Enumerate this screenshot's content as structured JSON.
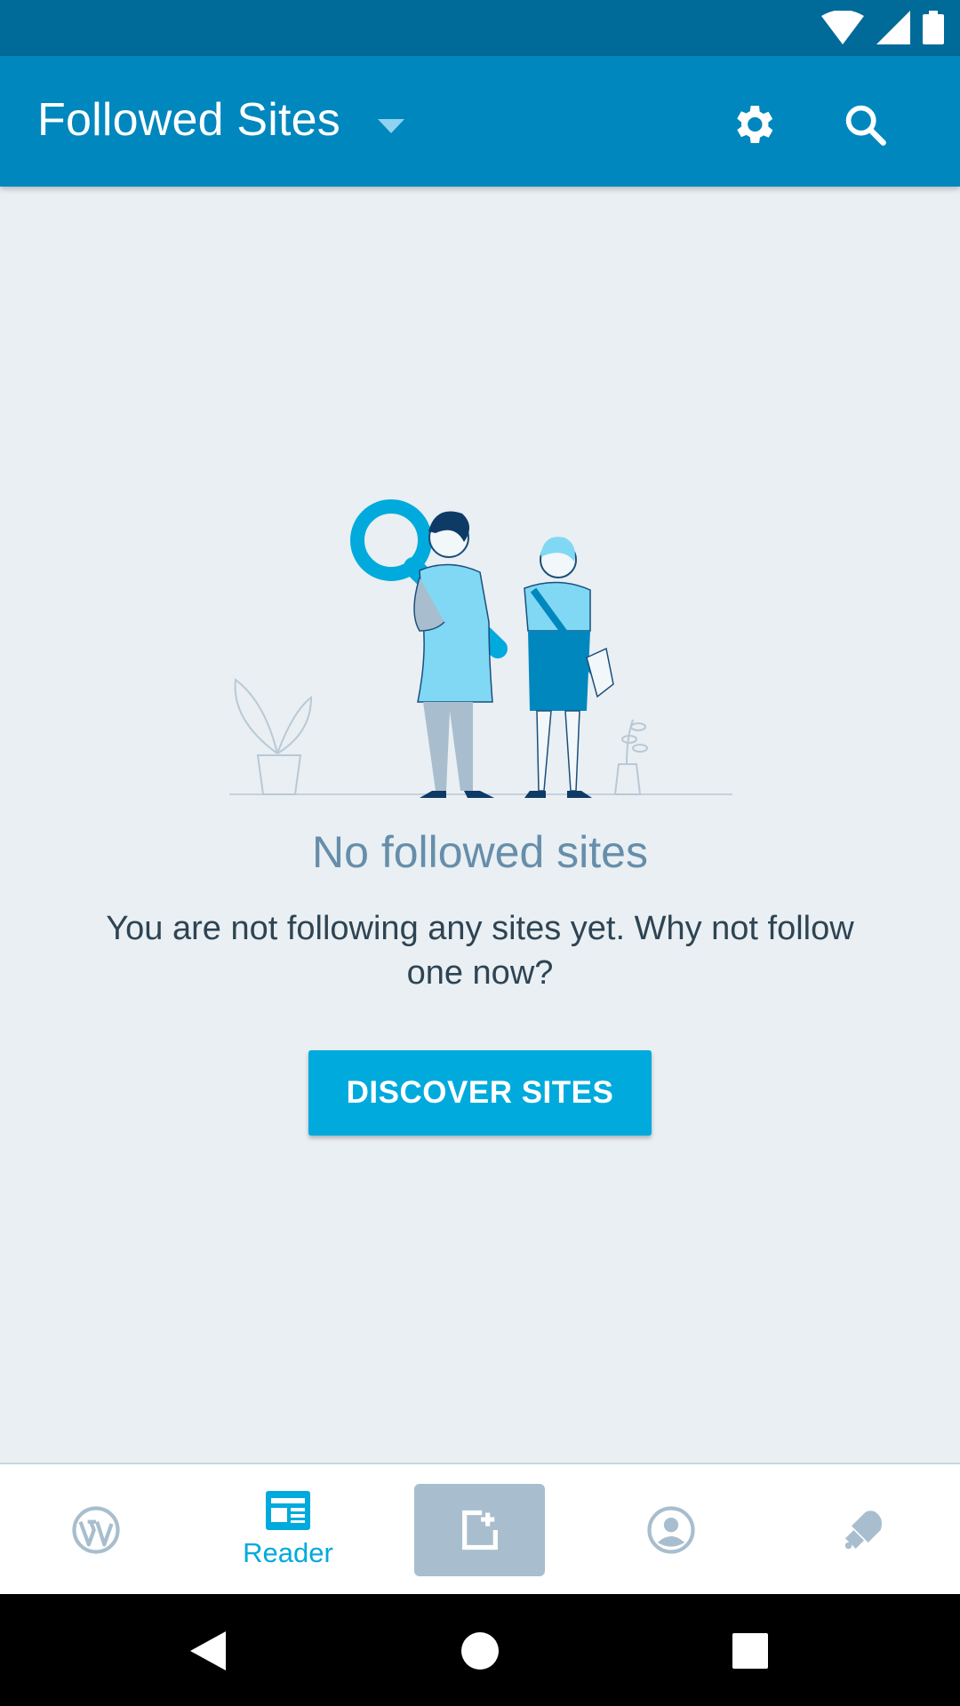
{
  "app_bar": {
    "title": "Followed Sites"
  },
  "empty_state": {
    "title": "No followed sites",
    "description": "You are not following any sites yet. Why not follow one now?",
    "button_label": "DISCOVER SITES"
  },
  "bottom_nav": {
    "items": [
      {
        "icon": "wordpress-icon",
        "label": ""
      },
      {
        "icon": "reader-icon",
        "label": "Reader"
      },
      {
        "icon": "write-post-icon",
        "label": ""
      },
      {
        "icon": "profile-icon",
        "label": ""
      },
      {
        "icon": "notifications-bell-icon",
        "label": ""
      }
    ],
    "active_item": "Reader"
  },
  "colors": {
    "status_bar": "#006a99",
    "app_bar": "#0087be",
    "accent": "#00aadc",
    "background": "#e9eff3",
    "muted_icon": "#a8bece"
  }
}
